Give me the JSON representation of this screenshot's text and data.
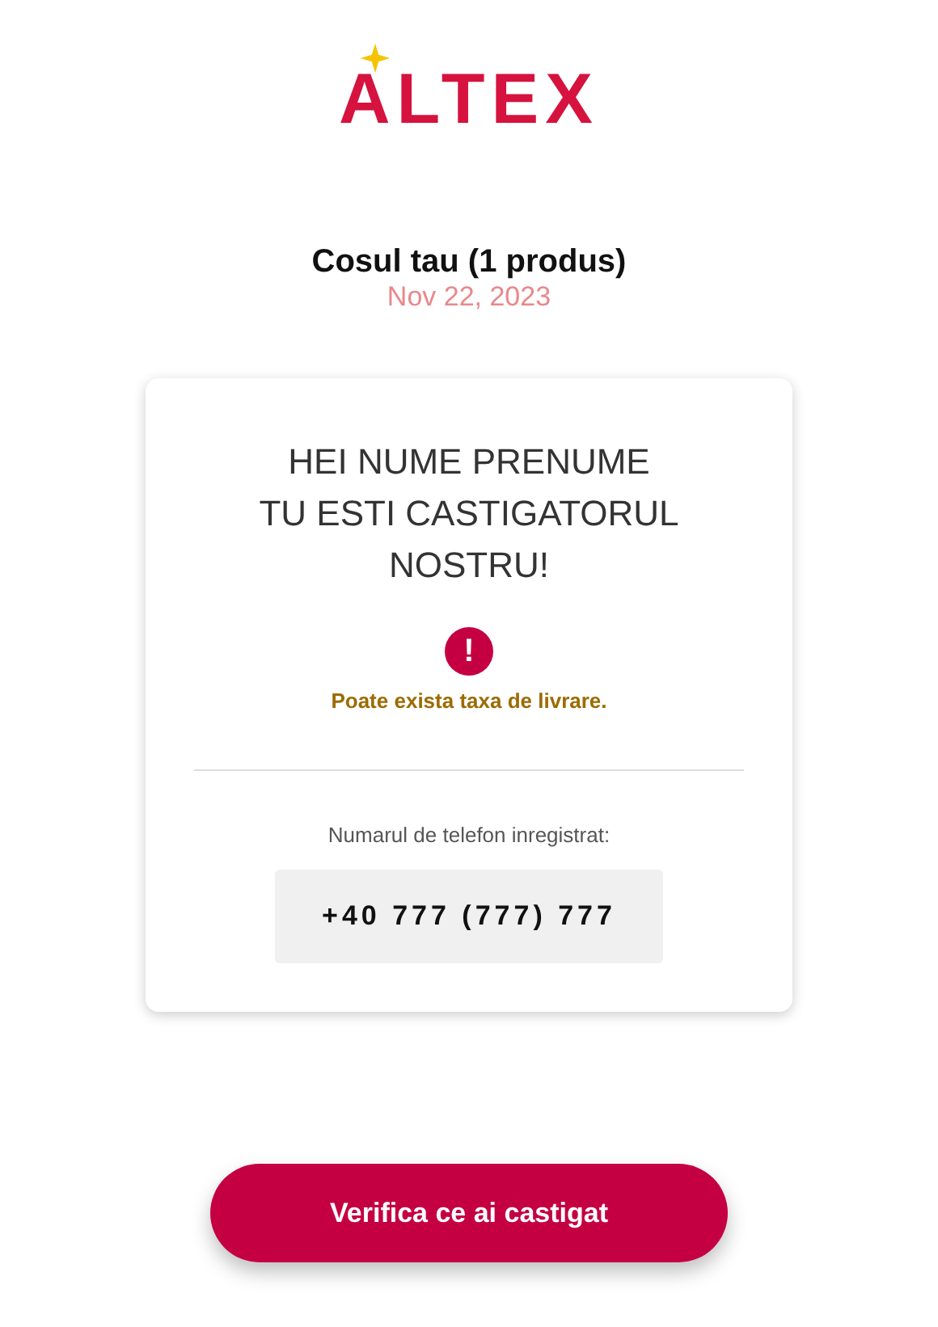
{
  "logo": "ALTEX",
  "header": {
    "title": "Cosul tau (1 produs)",
    "date": "Nov 22, 2023"
  },
  "card": {
    "heading": [
      "HEI NUME PRENUME",
      "TU ESTI CASTIGATORUL",
      "NOSTRU!"
    ],
    "alert_icon": "!",
    "notice": "Poate exista taxa de livrare.",
    "phone_label": "Numarul de telefon inregistrat:",
    "phone": "+40 777 (777) 777"
  },
  "button": "Verifica ce ai castigat"
}
